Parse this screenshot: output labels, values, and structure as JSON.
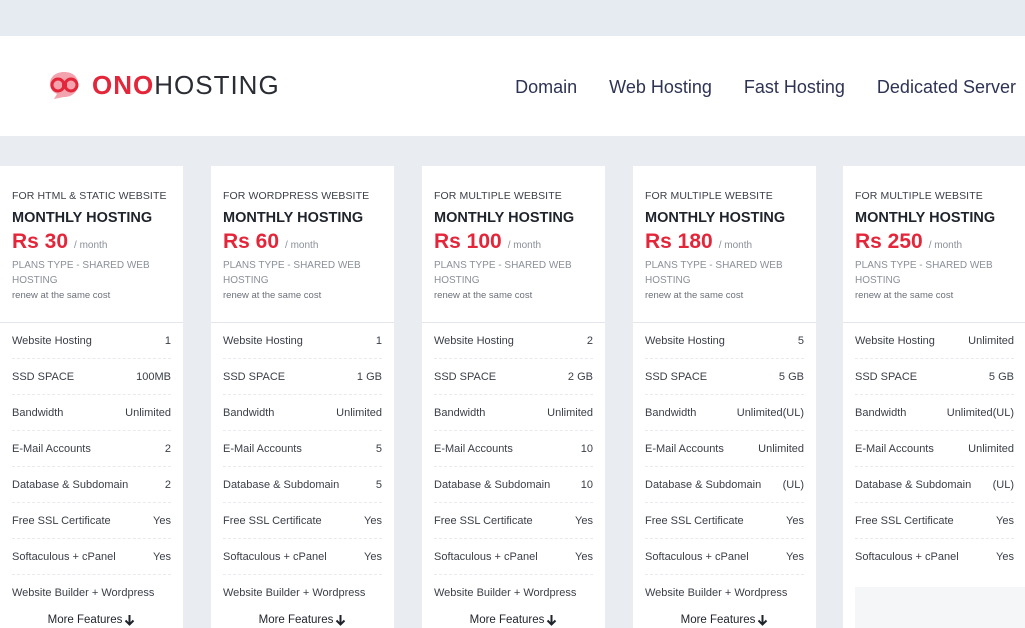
{
  "brand": {
    "ono": "ONO",
    "hosting": "HOSTING",
    "accent": "#e3263a"
  },
  "nav": [
    {
      "label": "Domain"
    },
    {
      "label": "Web Hosting"
    },
    {
      "label": "Fast Hosting"
    },
    {
      "label": "Dedicated Server"
    }
  ],
  "plans": [
    {
      "for": "FOR HTML & STATIC WEBSITE",
      "title": "MONTHLY HOSTING",
      "price": "Rs 30",
      "per": "/ month",
      "type": "PLANS TYPE - SHARED WEB HOSTING",
      "renew": "renew at the same cost",
      "features": [
        {
          "label": "Website Hosting",
          "value": "1"
        },
        {
          "label": "SSD SPACE",
          "value": "100MB"
        },
        {
          "label": "Bandwidth",
          "value": "Unlimited"
        },
        {
          "label": "E-Mail Accounts",
          "value": "2"
        },
        {
          "label": "Database & Subdomain",
          "value": "2"
        },
        {
          "label": "Free SSL Certificate",
          "value": "Yes"
        },
        {
          "label": "Softaculous + cPanel",
          "value": "Yes"
        },
        {
          "label": "Website Builder + Wordpress",
          "value": ""
        }
      ],
      "more": "More Features"
    },
    {
      "for": "FOR WORDPRESS WEBSITE",
      "title": "MONTHLY HOSTING",
      "price": "Rs 60",
      "per": "/ month",
      "type": "PLANS TYPE - SHARED WEB HOSTING",
      "renew": "renew at the same cost",
      "features": [
        {
          "label": "Website Hosting",
          "value": "1"
        },
        {
          "label": "SSD SPACE",
          "value": "1 GB"
        },
        {
          "label": "Bandwidth",
          "value": "Unlimited"
        },
        {
          "label": "E-Mail Accounts",
          "value": "5"
        },
        {
          "label": "Database & Subdomain",
          "value": "5"
        },
        {
          "label": "Free SSL Certificate",
          "value": "Yes"
        },
        {
          "label": "Softaculous + cPanel",
          "value": "Yes"
        },
        {
          "label": "Website Builder + Wordpress",
          "value": ""
        }
      ],
      "more": "More Features"
    },
    {
      "for": "FOR MULTIPLE WEBSITE",
      "title": "MONTHLY HOSTING",
      "price": "Rs 100",
      "per": "/ month",
      "type": "PLANS TYPE - SHARED WEB HOSTING",
      "renew": "renew at the same cost",
      "features": [
        {
          "label": "Website Hosting",
          "value": "2"
        },
        {
          "label": "SSD SPACE",
          "value": "2 GB"
        },
        {
          "label": "Bandwidth",
          "value": "Unlimited"
        },
        {
          "label": "E-Mail Accounts",
          "value": "10"
        },
        {
          "label": "Database & Subdomain",
          "value": "10"
        },
        {
          "label": "Free SSL Certificate",
          "value": "Yes"
        },
        {
          "label": "Softaculous + cPanel",
          "value": "Yes"
        },
        {
          "label": "Website Builder + Wordpress",
          "value": ""
        }
      ],
      "more": "More Features"
    },
    {
      "for": "FOR MULTIPLE WEBSITE",
      "title": "MONTHLY HOSTING",
      "price": "Rs 180",
      "per": "/ month",
      "type": "PLANS TYPE - SHARED WEB HOSTING",
      "renew": "renew at the same cost",
      "features": [
        {
          "label": "Website Hosting",
          "value": "5"
        },
        {
          "label": "SSD SPACE",
          "value": "5 GB"
        },
        {
          "label": "Bandwidth",
          "value": "Unlimited(UL)"
        },
        {
          "label": "E-Mail Accounts",
          "value": "Unlimited"
        },
        {
          "label": "Database & Subdomain",
          "value": "(UL)"
        },
        {
          "label": "Free SSL Certificate",
          "value": "Yes"
        },
        {
          "label": "Softaculous + cPanel",
          "value": "Yes"
        },
        {
          "label": "Website Builder + Wordpress",
          "value": ""
        }
      ],
      "more": "More Features"
    },
    {
      "for": "FOR MULTIPLE WEBSITE",
      "title": "MONTHLY HOSTING",
      "price": "Rs 250",
      "per": "/ month",
      "type": "PLANS TYPE - SHARED WEB HOSTING",
      "renew": "renew at the same cost",
      "features": [
        {
          "label": "Website Hosting",
          "value": "Unlimited"
        },
        {
          "label": "SSD SPACE",
          "value": "5 GB"
        },
        {
          "label": "Bandwidth",
          "value": "Unlimited(UL)"
        },
        {
          "label": "E-Mail Accounts",
          "value": "Unlimited"
        },
        {
          "label": "Database & Subdomain",
          "value": "(UL)"
        },
        {
          "label": "Free SSL Certificate",
          "value": "Yes"
        },
        {
          "label": "Softaculous + cPanel",
          "value": "Yes"
        }
      ],
      "more": ""
    }
  ]
}
